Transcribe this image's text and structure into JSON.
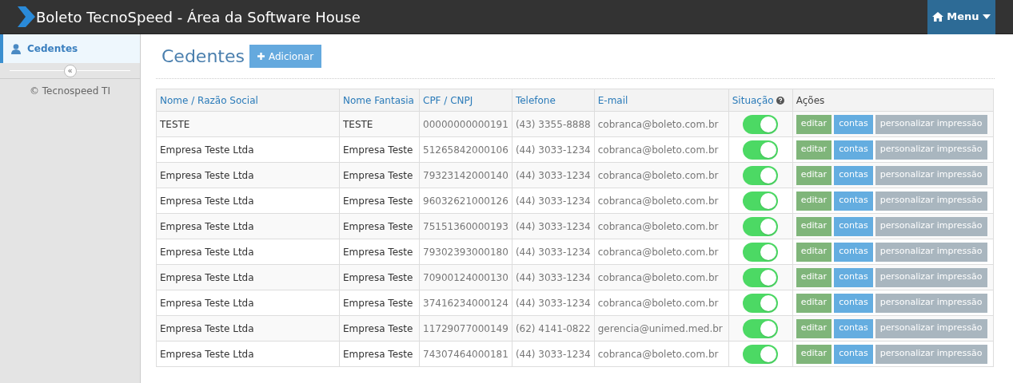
{
  "header": {
    "title": "Boleto TecnoSpeed - Área da Software House",
    "menu_button": "Menu"
  },
  "sidebar": {
    "items": [
      {
        "label": "Cedentes",
        "selected": true
      }
    ],
    "collapse_button": "«",
    "footer": "© Tecnospeed TI"
  },
  "page": {
    "title": "Cedentes",
    "add_button": "Adicionar"
  },
  "table": {
    "columns": [
      "Nome / Razão Social",
      "Nome Fantasia",
      "CPF / CNPJ",
      "Telefone",
      "E-mail",
      "Situação",
      "Ações"
    ],
    "rows": [
      {
        "cells": [
          "TESTE",
          "TESTE",
          "00000000000191",
          "(43) 3355-8888",
          "cobranca@boleto.com.br"
        ],
        "on": true,
        "actions": [
          "editar",
          "contas",
          "personalizar impressão"
        ]
      },
      {
        "cells": [
          "Empresa Teste Ltda",
          "Empresa Teste",
          "51265842000106",
          "(44) 3033-1234",
          "cobranca@boleto.com.br"
        ],
        "on": true,
        "actions": [
          "editar",
          "contas",
          "personalizar impressão"
        ]
      },
      {
        "cells": [
          "Empresa Teste Ltda",
          "Empresa Teste",
          "79323142000140",
          "(44) 3033-1234",
          "cobranca@boleto.com.br"
        ],
        "on": true,
        "actions": [
          "editar",
          "contas",
          "personalizar impressão"
        ]
      },
      {
        "cells": [
          "Empresa Teste Ltda",
          "Empresa Teste",
          "96032621000126",
          "(44) 3033-1234",
          "cobranca@boleto.com.br"
        ],
        "on": true,
        "actions": [
          "editar",
          "contas",
          "personalizar impressão"
        ]
      },
      {
        "cells": [
          "Empresa Teste Ltda",
          "Empresa Teste",
          "75151360000193",
          "(44) 3033-1234",
          "cobranca@boleto.com.br"
        ],
        "on": true,
        "actions": [
          "editar",
          "contas",
          "personalizar impressão"
        ]
      },
      {
        "cells": [
          "Empresa Teste Ltda",
          "Empresa Teste",
          "79302393000180",
          "(44) 3033-1234",
          "cobranca@boleto.com.br"
        ],
        "on": true,
        "actions": [
          "editar",
          "contas",
          "personalizar impressão"
        ]
      },
      {
        "cells": [
          "Empresa Teste Ltda",
          "Empresa Teste",
          "70900124000130",
          "(44) 3033-1234",
          "cobranca@boleto.com.br"
        ],
        "on": true,
        "actions": [
          "editar",
          "contas",
          "personalizar impressão"
        ]
      },
      {
        "cells": [
          "Empresa Teste Ltda",
          "Empresa Teste",
          "37416234000124",
          "(44) 3033-1234",
          "cobranca@boleto.com.br"
        ],
        "on": true,
        "actions": [
          "editar",
          "contas",
          "personalizar impressão"
        ]
      },
      {
        "cells": [
          "Empresa Teste Ltda",
          "Empresa Teste",
          "11729077000149",
          "(62) 4141-0822",
          "gerencia@unimed.med.br"
        ],
        "on": true,
        "actions": [
          "editar",
          "contas",
          "personalizar impressão"
        ]
      },
      {
        "cells": [
          "Empresa Teste Ltda",
          "Empresa Teste",
          "74307464000181",
          "(44) 3033-1234",
          "cobranca@boleto.com.br"
        ],
        "on": true,
        "actions": [
          "editar",
          "contas",
          "personalizar impressão"
        ]
      }
    ]
  }
}
